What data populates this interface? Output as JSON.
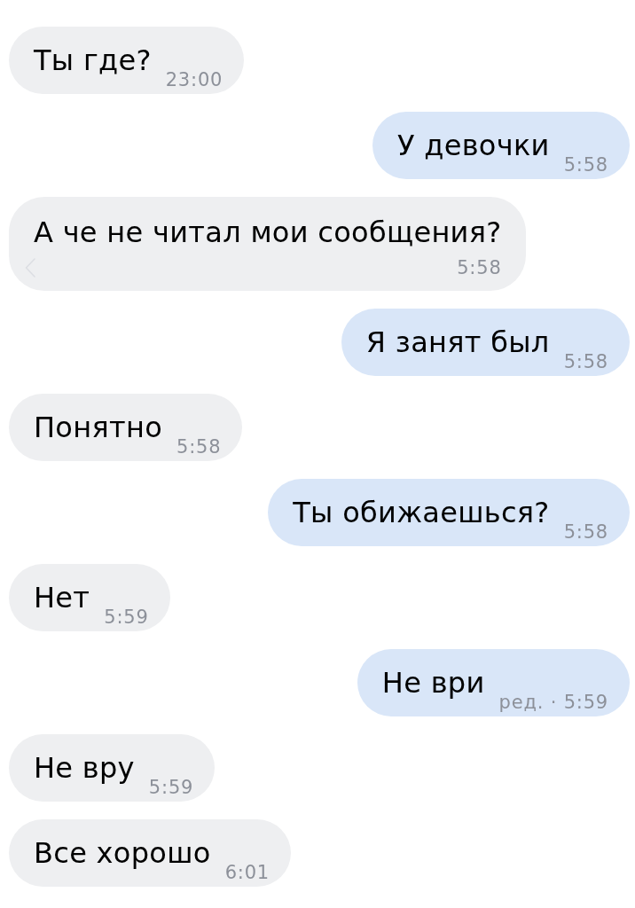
{
  "messages": [
    {
      "outgoing": false,
      "kind": "inline",
      "text": "Ты где?",
      "time": "23:00"
    },
    {
      "outgoing": true,
      "kind": "inline",
      "text": "У девочки",
      "time": "5:58"
    },
    {
      "outgoing": false,
      "kind": "stacked",
      "text": "А че не читал мои сообщения?",
      "time": "5:58"
    },
    {
      "outgoing": true,
      "kind": "inline",
      "text": "Я занят был",
      "time": "5:58"
    },
    {
      "outgoing": false,
      "kind": "inline",
      "text": "Понятно",
      "time": "5:58"
    },
    {
      "outgoing": true,
      "kind": "inline",
      "text": "Ты обижаешься?",
      "time": "5:58"
    },
    {
      "outgoing": false,
      "kind": "inline",
      "text": "Нет",
      "time": "5:59"
    },
    {
      "outgoing": true,
      "kind": "inline",
      "text": "Не ври",
      "time": "ред. · 5:59"
    },
    {
      "outgoing": false,
      "kind": "inline",
      "text": "Не вру",
      "time": "5:59"
    },
    {
      "outgoing": false,
      "kind": "inline",
      "text": "Все хорошо",
      "time": "6:01"
    }
  ]
}
